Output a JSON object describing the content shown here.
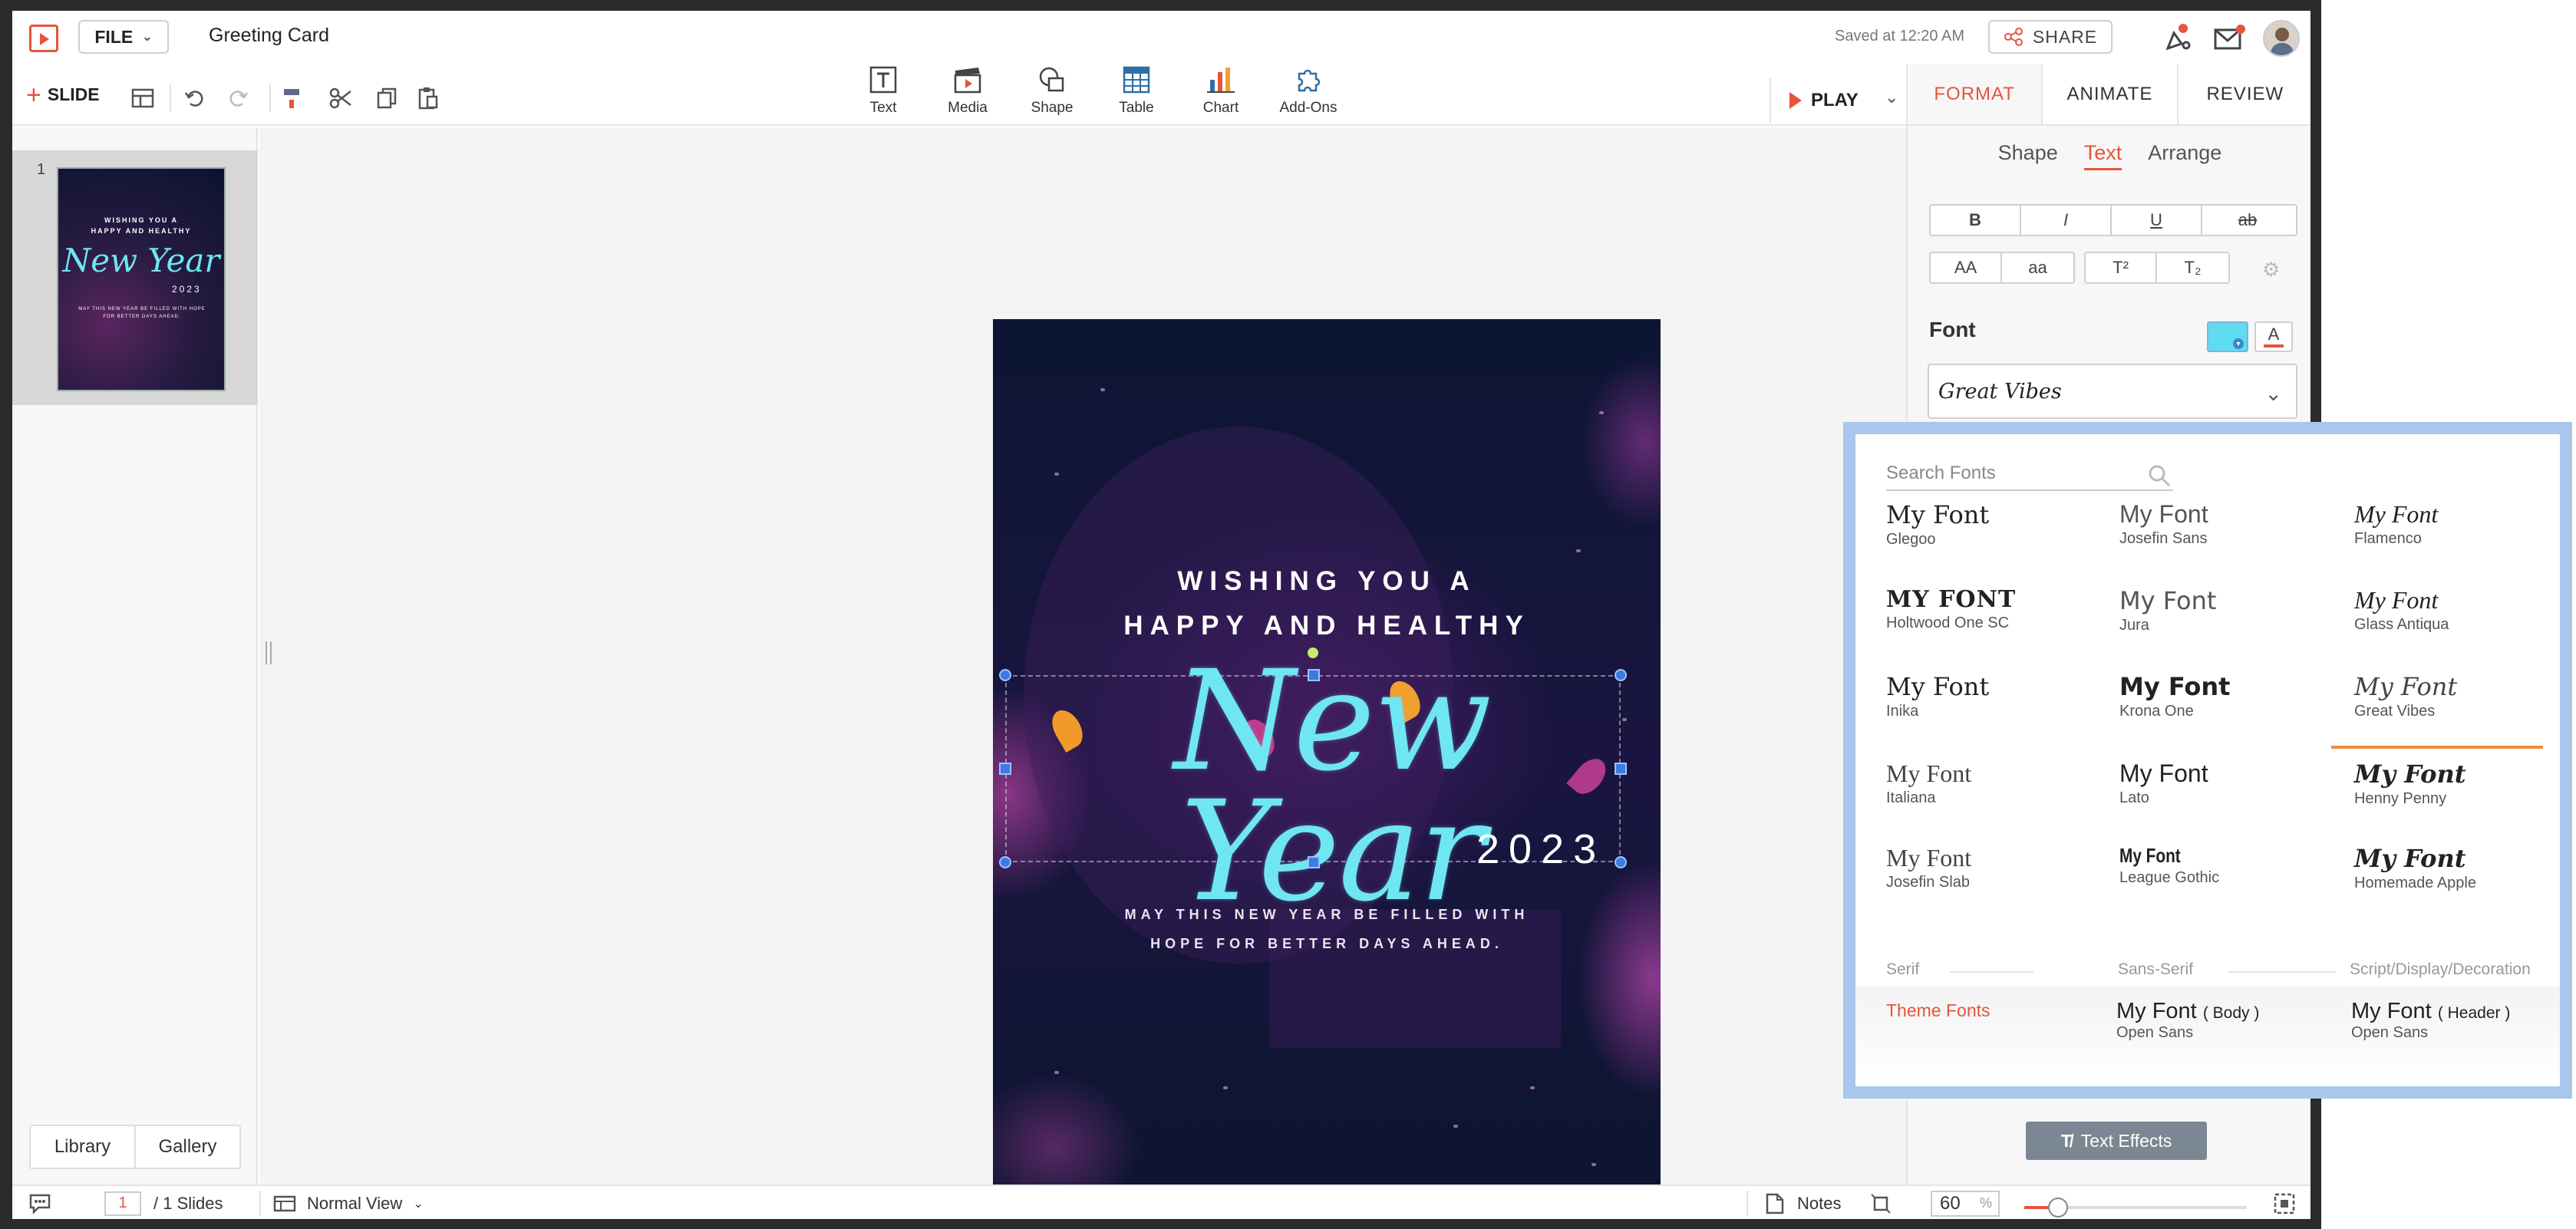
{
  "app": {
    "file_label": "FILE",
    "title": "Greeting Card",
    "saved_status": "Saved at 12:20 AM",
    "share_label": "SHARE"
  },
  "toolbar": {
    "new_slide_label": "SLIDE",
    "insert": [
      {
        "label": "Text",
        "icon": "text-box-icon"
      },
      {
        "label": "Media",
        "icon": "media-icon"
      },
      {
        "label": "Shape",
        "icon": "shape-icon"
      },
      {
        "label": "Table",
        "icon": "table-icon"
      },
      {
        "label": "Chart",
        "icon": "chart-icon"
      },
      {
        "label": "Add-Ons",
        "icon": "puzzle-icon"
      }
    ],
    "play_label": "PLAY"
  },
  "right_panel": {
    "tabs": [
      "FORMAT",
      "ANIMATE",
      "REVIEW"
    ],
    "active_tab": "FORMAT",
    "subtabs": [
      "Shape",
      "Text",
      "Arrange"
    ],
    "active_subtab": "Text",
    "style_buttons": [
      "B",
      "I",
      "U",
      "ab"
    ],
    "case_buttons": [
      "AA",
      "aa",
      "T²",
      "T₂"
    ],
    "font_label": "Font",
    "font_color": "#5fdcf0",
    "text_color_glyph": "A",
    "selected_font": "Great Vibes",
    "text_effects_label": "Text Effects"
  },
  "font_popup": {
    "search_placeholder": "Search Fonts",
    "fonts": [
      {
        "sample": "My Font",
        "name": "Glegoo"
      },
      {
        "sample": "My Font",
        "name": "Josefin Sans"
      },
      {
        "sample": "My Font",
        "name": "Flamenco"
      },
      {
        "sample": "MY FONT",
        "name": "Holtwood One SC"
      },
      {
        "sample": "My Font",
        "name": "Jura"
      },
      {
        "sample": "My Font",
        "name": "Glass Antiqua"
      },
      {
        "sample": "My Font",
        "name": "Inika"
      },
      {
        "sample": "My Font",
        "name": "Krona One"
      },
      {
        "sample": "My Font",
        "name": "Great Vibes",
        "selected": true
      },
      {
        "sample": "My Font",
        "name": "Italiana"
      },
      {
        "sample": "My Font",
        "name": "Lato"
      },
      {
        "sample": "My Font",
        "name": "Henny Penny"
      },
      {
        "sample": "My Font",
        "name": "Josefin Slab"
      },
      {
        "sample": "My Font",
        "name": "League Gothic"
      },
      {
        "sample": "My Font",
        "name": "Homemade Apple"
      }
    ],
    "categories": [
      "Serif",
      "Sans-Serif",
      "Script/Display/Decoration"
    ],
    "theme_fonts_label": "Theme Fonts",
    "theme_fonts": [
      {
        "sample": "My Font",
        "role": "( Body )",
        "name": "Open Sans"
      },
      {
        "sample": "My Font",
        "role": "( Header )",
        "name": "Open Sans"
      }
    ]
  },
  "slide": {
    "line1": "WISHING YOU A",
    "line2": "HAPPY AND HEALTHY",
    "headline": "New Year",
    "year": "2023",
    "wish1": "MAY THIS NEW YEAR BE FILLED WITH",
    "wish2": "HOPE FOR BETTER DAYS AHEAD."
  },
  "thumbnail": {
    "number": "1",
    "line1": "WISHING YOU A",
    "line2": "HAPPY AND HEALTHY",
    "headline": "New Year",
    "year": "2023",
    "wish": "MAY THIS NEW YEAR BE FILLED WITH HOPE FOR BETTER DAYS AHEAD."
  },
  "left_panel": {
    "library_label": "Library",
    "gallery_label": "Gallery"
  },
  "status_bar": {
    "current_page": "1",
    "total_pages": "/  1 Slides",
    "view_label": "Normal View",
    "notes_label": "Notes",
    "zoom_value": "60",
    "zoom_unit": "%",
    "zoom_fraction": 0.15
  },
  "colors": {
    "accent": "#e5553b",
    "headline": "#6fe6f2",
    "popup_border": "#a9c6ec"
  }
}
